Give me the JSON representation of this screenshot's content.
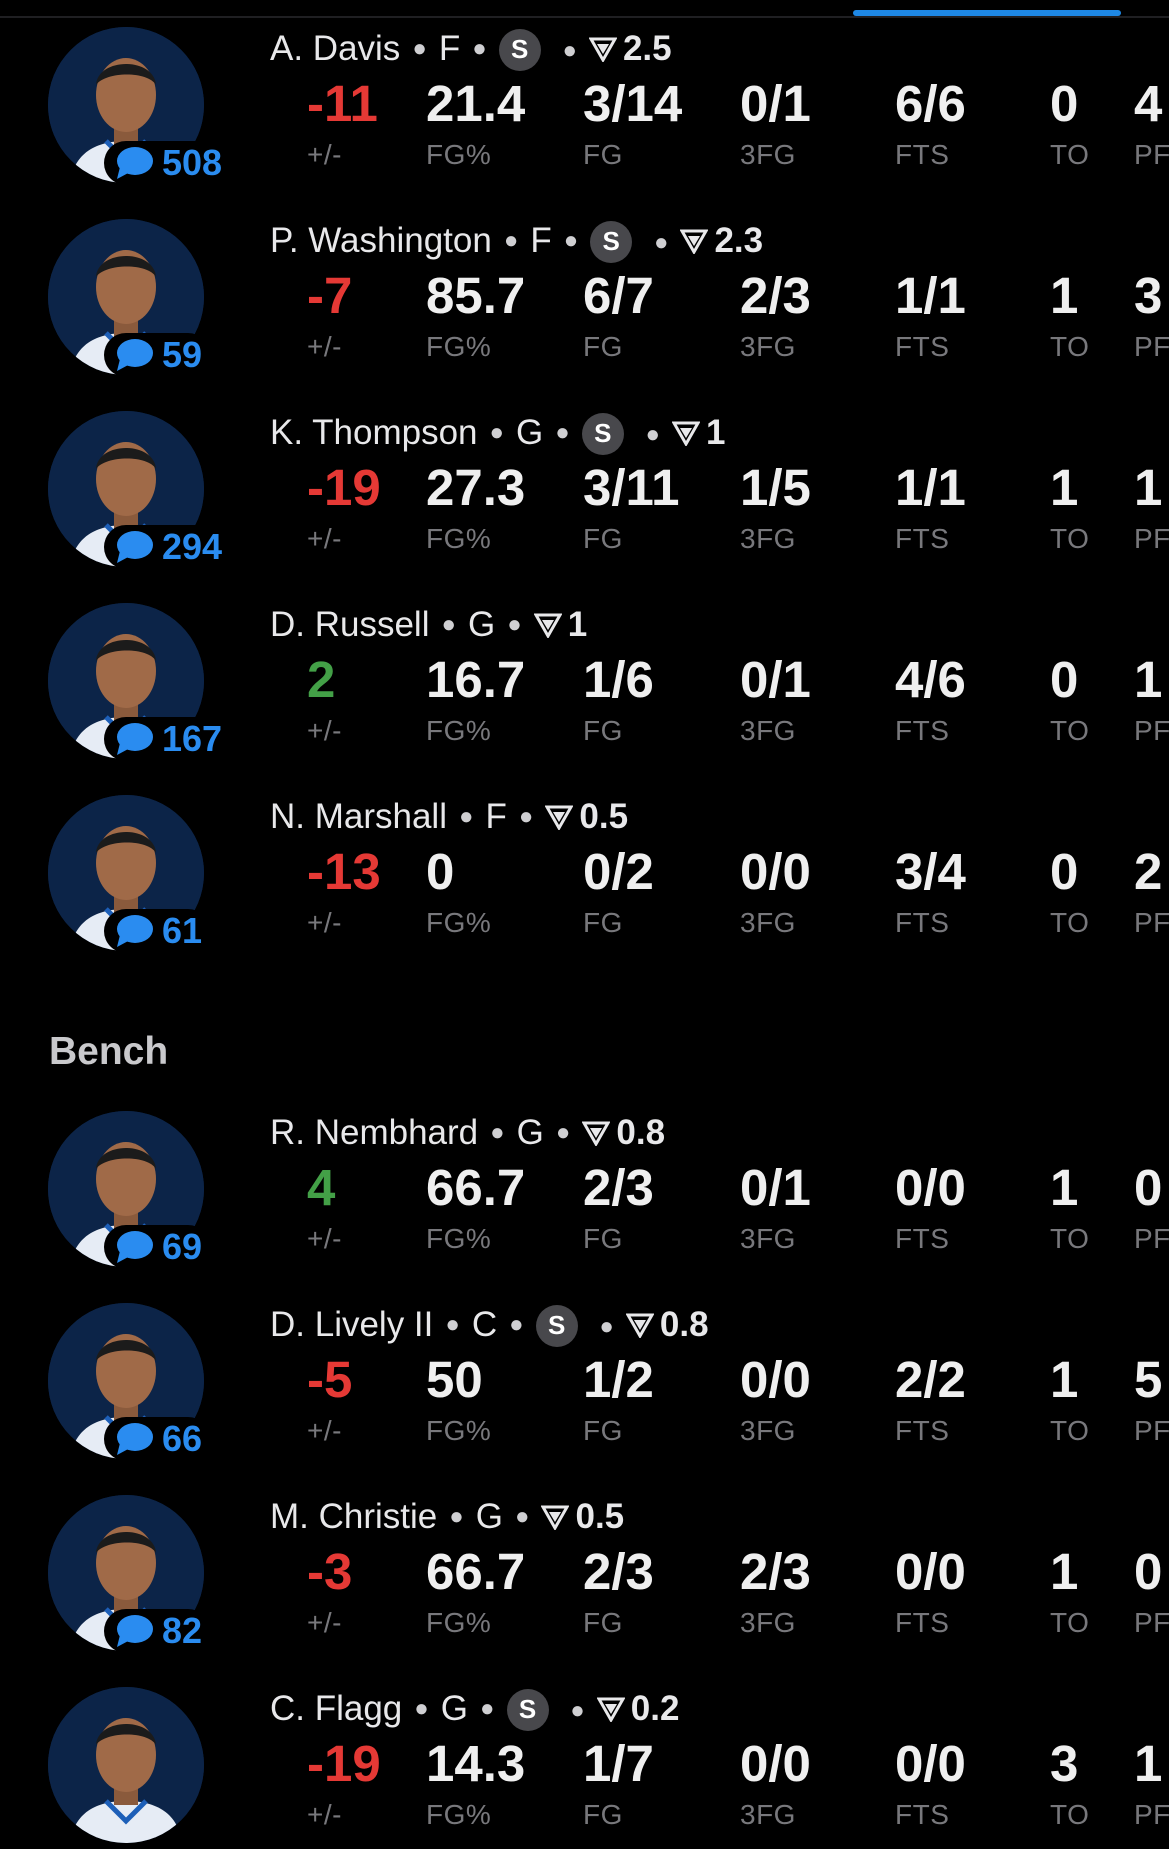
{
  "colors": {
    "negative": "#e53935",
    "positive": "#43a047",
    "accent": "#2a8cf0",
    "background": "#000000",
    "label": "#78787c"
  },
  "icons": {
    "comment": "speech-bubble-icon",
    "rating": "triangle-rating-icon",
    "starter": "starter-s-badge"
  },
  "bench_header": "Bench",
  "stat_labels": {
    "pm": "+/-",
    "fgp": "FG%",
    "fg": "FG",
    "three": "3FG",
    "fts": "FTS",
    "to": "TO",
    "pf": "PF"
  },
  "starters": [
    {
      "name": "A. Davis",
      "pos": "F",
      "starter_badge": "S",
      "rating": "2.5",
      "comments": "508",
      "pm": "-11",
      "fgp": "21.4",
      "fg": "3/14",
      "three": "0/1",
      "fts": "6/6",
      "to": "0",
      "pf": "4"
    },
    {
      "name": "P. Washington",
      "pos": "F",
      "starter_badge": "S",
      "rating": "2.3",
      "comments": "59",
      "pm": "-7",
      "fgp": "85.7",
      "fg": "6/7",
      "three": "2/3",
      "fts": "1/1",
      "to": "1",
      "pf": "3"
    },
    {
      "name": "K. Thompson",
      "pos": "G",
      "starter_badge": "S",
      "rating": "1",
      "comments": "294",
      "pm": "-19",
      "fgp": "27.3",
      "fg": "3/11",
      "three": "1/5",
      "fts": "1/1",
      "to": "1",
      "pf": "1"
    },
    {
      "name": "D. Russell",
      "pos": "G",
      "starter_badge": "",
      "rating": "1",
      "comments": "167",
      "pm": "2",
      "fgp": "16.7",
      "fg": "1/6",
      "three": "0/1",
      "fts": "4/6",
      "to": "0",
      "pf": "1"
    },
    {
      "name": "N. Marshall",
      "pos": "F",
      "starter_badge": "",
      "rating": "0.5",
      "comments": "61",
      "pm": "-13",
      "fgp": "0",
      "fg": "0/2",
      "three": "0/0",
      "fts": "3/4",
      "to": "0",
      "pf": "2"
    }
  ],
  "bench": [
    {
      "name": "R. Nembhard",
      "pos": "G",
      "starter_badge": "",
      "rating": "0.8",
      "comments": "69",
      "pm": "4",
      "fgp": "66.7",
      "fg": "2/3",
      "three": "0/1",
      "fts": "0/0",
      "to": "1",
      "pf": "0"
    },
    {
      "name": "D. Lively II",
      "pos": "C",
      "starter_badge": "S",
      "rating": "0.8",
      "comments": "66",
      "pm": "-5",
      "fgp": "50",
      "fg": "1/2",
      "three": "0/0",
      "fts": "2/2",
      "to": "1",
      "pf": "5"
    },
    {
      "name": "M. Christie",
      "pos": "G",
      "starter_badge": "",
      "rating": "0.5",
      "comments": "82",
      "pm": "-3",
      "fgp": "66.7",
      "fg": "2/3",
      "three": "2/3",
      "fts": "0/0",
      "to": "1",
      "pf": "0"
    },
    {
      "name": "C. Flagg",
      "pos": "G",
      "starter_badge": "S",
      "rating": "0.2",
      "comments": "",
      "pm": "-19",
      "fgp": "14.3",
      "fg": "1/7",
      "three": "0/0",
      "fts": "0/0",
      "to": "3",
      "pf": "1"
    }
  ]
}
